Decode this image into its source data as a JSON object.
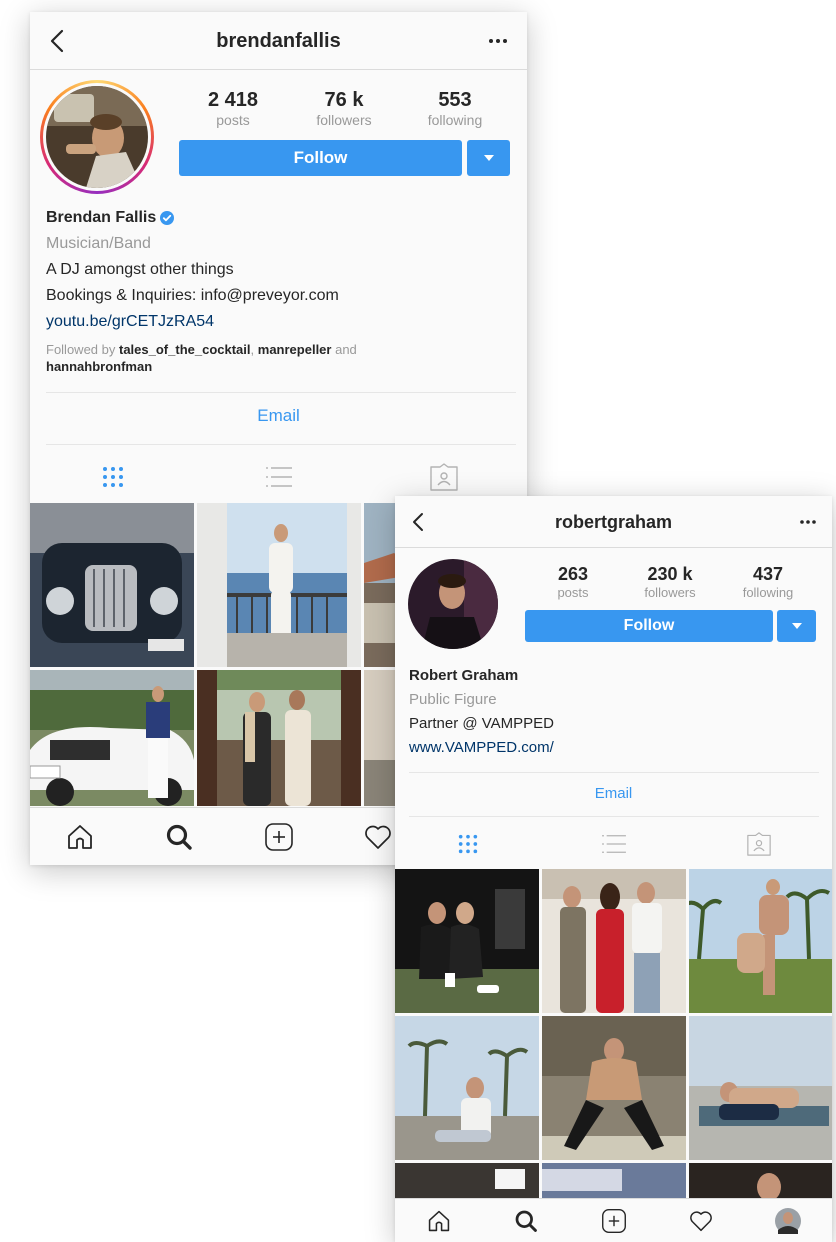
{
  "profile1": {
    "username": "brendanfallis",
    "stats": {
      "posts": {
        "value": "2 418",
        "label": "posts"
      },
      "followers": {
        "value": "76 k",
        "label": "followers"
      },
      "following": {
        "value": "553",
        "label": "following"
      }
    },
    "follow_label": "Follow",
    "full_name": "Brendan Fallis",
    "verified": true,
    "category": "Musician/Band",
    "bio_lines": [
      "A DJ amongst other things",
      "Bookings & Inquiries: info@preveyor.com"
    ],
    "website": "youtu.be/grCETJzRA54",
    "followed_by": {
      "prefix": "Followed by",
      "names": [
        "tales_of_the_cocktail",
        "manrepeller",
        "hannahbronfman"
      ],
      "separator": ",",
      "conjunction": "and"
    },
    "email_label": "Email"
  },
  "profile2": {
    "username": "robertgraham",
    "stats": {
      "posts": {
        "value": "263",
        "label": "posts"
      },
      "followers": {
        "value": "230 k",
        "label": "followers"
      },
      "following": {
        "value": "437",
        "label": "following"
      }
    },
    "follow_label": "Follow",
    "full_name": "Robert Graham",
    "category": "Public Figure",
    "bio_lines": [
      "Partner @ VAMPPED"
    ],
    "website": "www.VAMPPED.com/",
    "email_label": "Email"
  },
  "icons": {
    "back": "chevron-left-icon",
    "more": "more-horizontal-icon",
    "grid_tab": "grid-icon",
    "list_tab": "list-icon",
    "tagged_tab": "tagged-icon",
    "home": "home-icon",
    "search": "search-icon",
    "add": "add-post-icon",
    "activity": "heart-icon",
    "profile": "avatar"
  },
  "colors": {
    "accent_blue": "#3897f0",
    "link_blue": "#003569",
    "text_dark": "#262626",
    "text_gray": "#999999",
    "notification_red": "#ed4956",
    "story_ring_start": "#feda75",
    "story_ring_end": "#962fbf"
  }
}
